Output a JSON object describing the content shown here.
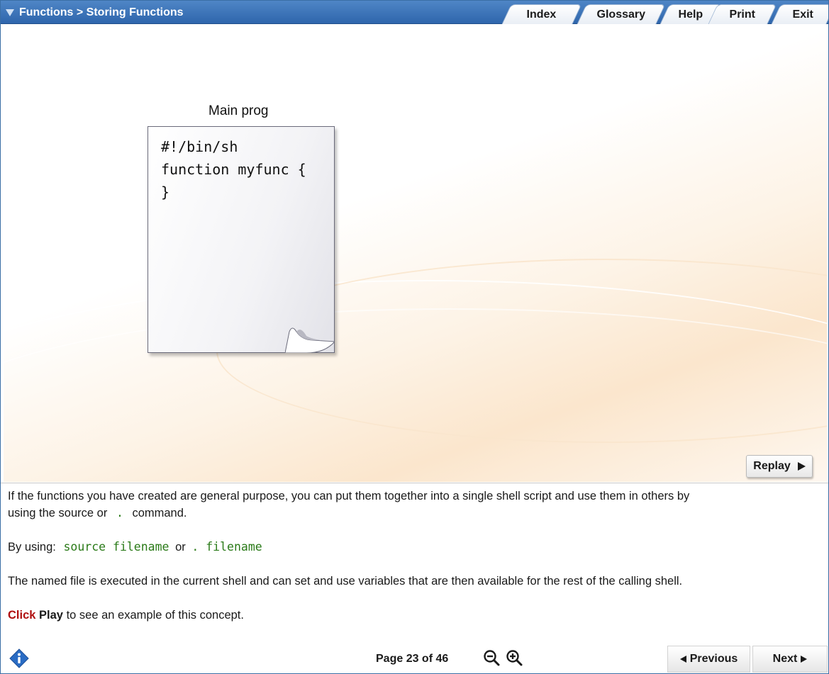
{
  "header": {
    "breadcrumb": "Functions > Storing Functions",
    "tabs": [
      "Index",
      "Glossary",
      "Help",
      "Print",
      "Exit"
    ]
  },
  "stage": {
    "doc_title": "Main prog",
    "code_lines": [
      "#!/bin/sh",
      "function myfunc {",
      "}"
    ],
    "replay_label": "Replay"
  },
  "content": {
    "p1_line1": "If the functions you have created are general purpose, you can put them together into a single shell script and use them in others by",
    "p1_line2_a": "using the source or",
    "p1_line2_code": ".",
    "p1_line2_b": "command.",
    "p2_prefix": "By using:",
    "p2_code1": "source filename",
    "p2_or": "or",
    "p2_code2": ". filename",
    "p3": "The named file is executed in the current shell and can set and use variables that are then available for the rest of the calling shell.",
    "p4_click": "Click",
    "p4_play": "Play",
    "p4_rest": "to see an example of this concept."
  },
  "footer": {
    "page_label": "Page 23 of 46",
    "previous_label": "Previous",
    "next_label": "Next"
  },
  "colors": {
    "header_blue": "#2f66ac",
    "code_green": "#2a7a18",
    "click_red": "#b01010",
    "info_blue": "#2a6cc4"
  }
}
